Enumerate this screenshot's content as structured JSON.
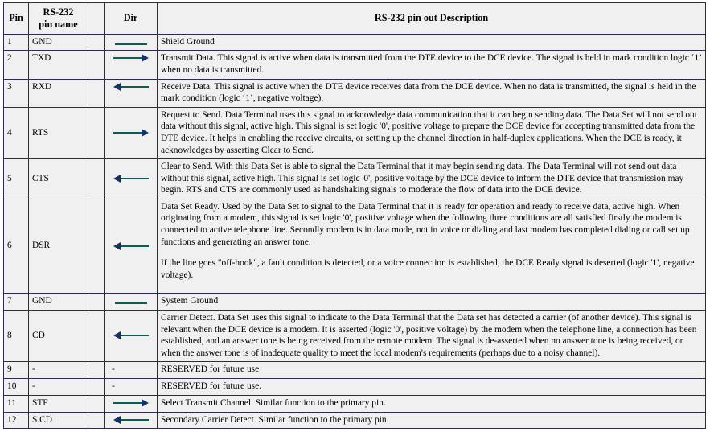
{
  "table": {
    "headers": {
      "pin": "Pin",
      "pin_name_line1": "RS-232",
      "pin_name_line2": "pin name",
      "dir": "Dir",
      "description": "RS-232 pin out Description"
    },
    "rows": [
      {
        "pin": "1",
        "name": "GND",
        "dir_icon": "line-no-arrow",
        "dir_text": "",
        "paragraphs": [
          "Shield Ground"
        ]
      },
      {
        "pin": "2",
        "name": "TXD",
        "dir_icon": "arrow-right",
        "dir_text": "",
        "paragraphs": [
          "Transmit Data. This signal is active when data is transmitted from the DTE device to the DCE device.  The signal is held in mark condition logic ‘1’ when no data is transmitted."
        ]
      },
      {
        "pin": "3",
        "name": "RXD",
        "dir_icon": "arrow-left",
        "dir_text": "",
        "paragraphs": [
          "Receive Data.  This signal is active when the DTE device receives  data from the DCE device. When no data is transmitted, the signal is held in the mark condition (logic ‘1’, negative voltage)."
        ]
      },
      {
        "pin": "4",
        "name": "RTS",
        "dir_icon": "arrow-right",
        "dir_text": "",
        "paragraphs": [
          "Request to Send. Data Terminal uses this signal to acknowledge data communication  that it can begin sending data. The Data Set will not send out data without this signal, active high. This signal is set logic '0', positive voltage to prepare the DCE device for accepting transmitted  data from the DTE device. It helps in enabling  the receive circuits, or setting up the channel direction  in half-duplex applications. When the DCE is ready, it acknowledges by asserting Clear to Send."
        ]
      },
      {
        "pin": "5",
        "name": "CTS",
        "dir_icon": "arrow-left",
        "dir_text": "",
        "paragraphs": [
          "Clear to Send. With this Data Set is able to signal the Data Terminal that it may begin sending data. The Data Terminal  will not send out data without this signal, active high.  This signal is set logic '0', positive voltage by the DCE device to inform the DTE device that transmission may begin. RTS and CTS are commonly used as handshaking signals to moderate the flow of data into the DCE device."
        ]
      },
      {
        "pin": "6",
        "name": "DSR",
        "dir_icon": "arrow-left",
        "dir_text": "",
        "paragraphs": [
          "Data Set Ready. Used by the Data Set to signal to the Data Terminal that it is ready for operation and ready to receive data, active high. When originating from a modem, this signal is set logic '0', positive voltage when the following three conditions are all satisfied firstly the modem is connected to active telephone line. Secondly modem is in data mode, not in voice or dialing and last modem has completed dialing or call set up functions and generating  an answer tone.",
          "If the line goes \"off-hook\", a fault condition is detected, or a voice connection is established, the DCE Ready signal is deserted (logic '1', negative voltage)."
        ]
      },
      {
        "pin": "7",
        "name": "GND",
        "dir_icon": "line-no-arrow",
        "dir_text": "",
        "paragraphs": [
          "System Ground"
        ]
      },
      {
        "pin": "8",
        "name": "CD",
        "dir_icon": "arrow-left",
        "dir_text": "",
        "paragraphs": [
          "Carrier Detect. Data Set uses this signal to indicate to the Data Terminal that the Data set has detected a carrier (of another device).  This signal is relevant when the DCE device is a modem. It is asserted (logic '0', positive voltage) by the modem when the telephone line, a connection  has been established, and an answer tone is being received from the remote modem. The signal is de-asserted when no answer tone is being received,  or when the answer tone is of inadequate  quality  to meet the local modem's requirements  (perhaps due to a noisy channel)."
        ]
      },
      {
        "pin": "9",
        "name": "-",
        "dir_icon": "text",
        "dir_text": "-",
        "paragraphs": [
          "RESERVED for future use"
        ]
      },
      {
        "pin": "10",
        "name": "-",
        "dir_icon": "text",
        "dir_text": "-",
        "paragraphs": [
          "RESERVED for future use."
        ]
      },
      {
        "pin": "11",
        "name": "STF",
        "dir_icon": "arrow-right",
        "dir_text": "",
        "paragraphs": [
          "Select Transmit Channel. Similar function to the primary pin."
        ]
      },
      {
        "pin": "12",
        "name": "S.CD",
        "dir_icon": "arrow-left",
        "dir_text": "",
        "paragraphs": [
          "Secondary Carrier Detect. Similar function to the primary pin."
        ]
      }
    ]
  },
  "colors": {
    "border": "#2b2b4b",
    "cell_background": "#f0f0f0",
    "arrow_shaft": "#0b5d56",
    "arrow_head": "#14306b",
    "text": "#000000"
  }
}
